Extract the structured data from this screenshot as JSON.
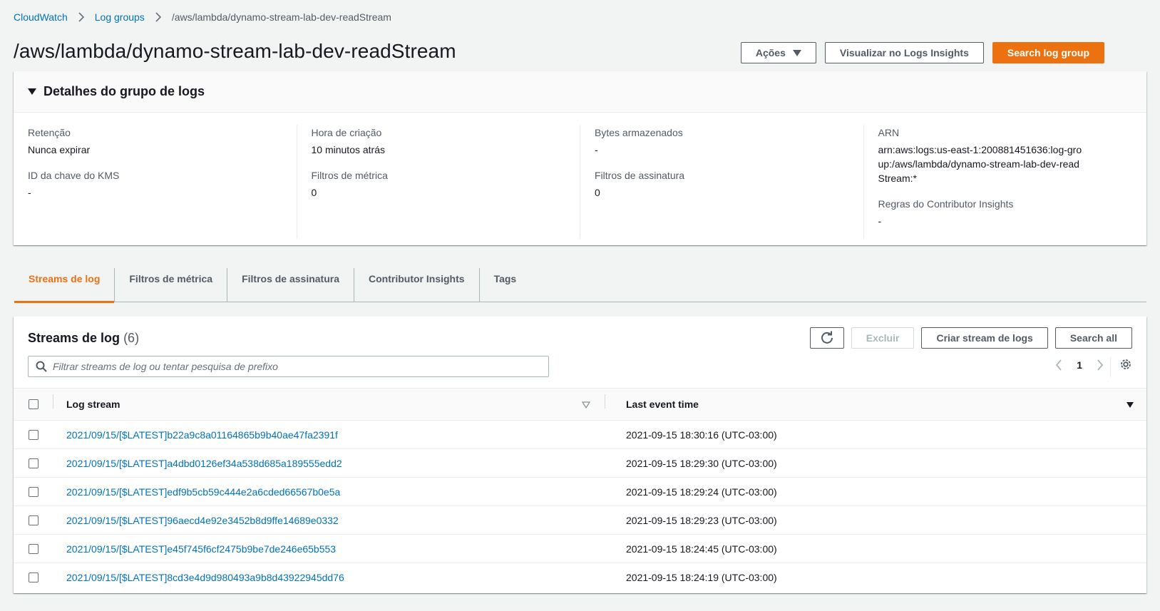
{
  "breadcrumb": {
    "items": [
      "CloudWatch",
      "Log groups"
    ],
    "current": "/aws/lambda/dynamo-stream-lab-dev-readStream"
  },
  "page": {
    "title": "/aws/lambda/dynamo-stream-lab-dev-readStream"
  },
  "header_actions": {
    "actions_label": "Ações",
    "insights_label": "Visualizar no Logs Insights",
    "search_label": "Search log group"
  },
  "details": {
    "title": "Detalhes do grupo de logs",
    "retention": {
      "label": "Retenção",
      "value": "Nunca expirar"
    },
    "kms": {
      "label": "ID da chave do KMS",
      "value": "-"
    },
    "created": {
      "label": "Hora de criação",
      "value": "10 minutos atrás"
    },
    "metric_filters": {
      "label": "Filtros de métrica",
      "value": "0"
    },
    "stored_bytes": {
      "label": "Bytes armazenados",
      "value": "-"
    },
    "subscription_filters": {
      "label": "Filtros de assinatura",
      "value": "0"
    },
    "arn": {
      "label": "ARN",
      "value": "arn:aws:logs:us-east-1:200881451636:log-group:/aws/lambda/dynamo-stream-lab-dev-readStream:*"
    },
    "contributor": {
      "label": "Regras do Contributor Insights",
      "value": "-"
    }
  },
  "tabs": [
    "Streams de log",
    "Filtros de métrica",
    "Filtros de assinatura",
    "Contributor Insights",
    "Tags"
  ],
  "streams": {
    "title": "Streams de log",
    "count": "(6)",
    "delete_label": "Excluir",
    "create_label": "Criar stream de logs",
    "search_all_label": "Search all",
    "filter_placeholder": "Filtrar streams de log ou tentar pesquisa de prefixo",
    "page_number": "1",
    "columns": {
      "stream": "Log stream",
      "time": "Last event time"
    },
    "rows": [
      {
        "stream": "2021/09/15/[$LATEST]b22a9c8a01164865b9b40ae47fa2391f",
        "time": "2021-09-15 18:30:16 (UTC-03:00)"
      },
      {
        "stream": "2021/09/15/[$LATEST]a4dbd0126ef34a538d685a189555edd2",
        "time": "2021-09-15 18:29:30 (UTC-03:00)"
      },
      {
        "stream": "2021/09/15/[$LATEST]edf9b5cb59c444e2a6cded66567b0e5a",
        "time": "2021-09-15 18:29:24 (UTC-03:00)"
      },
      {
        "stream": "2021/09/15/[$LATEST]96aecd4e92e3452b8d9ffe14689e0332",
        "time": "2021-09-15 18:29:23 (UTC-03:00)"
      },
      {
        "stream": "2021/09/15/[$LATEST]e45f745f6cf2475b9be7de246e65b553",
        "time": "2021-09-15 18:24:45 (UTC-03:00)"
      },
      {
        "stream": "2021/09/15/[$LATEST]8cd3e4d9d980493a9b8d43922945dd76",
        "time": "2021-09-15 18:24:19 (UTC-03:00)"
      }
    ]
  },
  "colors": {
    "accent": "#ec7211",
    "link": "#0073bb",
    "background": "#f2f3f3"
  },
  "icons": [
    "chevron-right-icon",
    "caret-down-icon",
    "refresh-icon",
    "search-icon",
    "chevron-left-icon",
    "gear-icon",
    "sort-icon"
  ]
}
